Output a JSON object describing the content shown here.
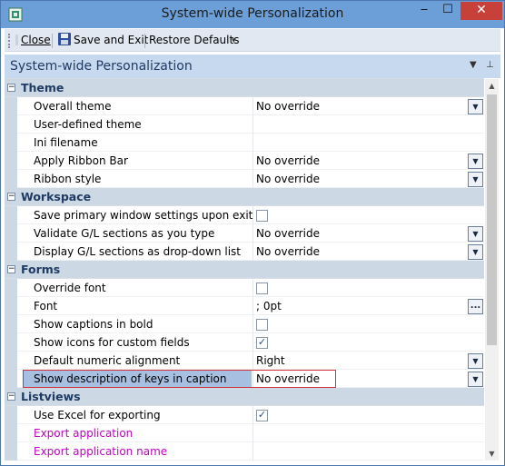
{
  "window": {
    "title": "System-wide Personalization",
    "minimize_glyph": "‒",
    "maximize_glyph": "☐",
    "close_glyph": "✕"
  },
  "toolbar": {
    "close_label": "Close",
    "save_label": "Save and Exit",
    "restore_label": "Restore Defaults"
  },
  "panel": {
    "title": "System-wide Personalization",
    "dropdown_glyph": "▼",
    "pin_glyph": "⊥"
  },
  "grid": {
    "categories": [
      {
        "label": "Theme",
        "toggle": "−",
        "rows": [
          {
            "label": "Overall theme",
            "type": "dropdown",
            "value": "No override"
          },
          {
            "label": "User-defined theme",
            "type": "text",
            "value": ""
          },
          {
            "label": "Ini filename",
            "type": "text",
            "value": ""
          },
          {
            "label": "Apply Ribbon Bar",
            "type": "dropdown",
            "value": "No override"
          },
          {
            "label": "Ribbon style",
            "type": "dropdown",
            "value": "No override"
          }
        ]
      },
      {
        "label": "Workspace",
        "toggle": "−",
        "rows": [
          {
            "label": "Save primary window settings upon exit",
            "type": "checkbox",
            "checked": false
          },
          {
            "label": "Validate G/L sections as you type",
            "type": "dropdown",
            "value": "No override"
          },
          {
            "label": "Display G/L sections as drop-down list",
            "type": "dropdown",
            "value": "No override"
          }
        ]
      },
      {
        "label": "Forms",
        "toggle": "−",
        "rows": [
          {
            "label": "Override font",
            "type": "checkbox",
            "checked": false
          },
          {
            "label": "Font",
            "type": "ellipsis",
            "value": "; 0pt"
          },
          {
            "label": "Show captions in bold",
            "type": "checkbox",
            "checked": false
          },
          {
            "label": "Show icons for custom fields",
            "type": "checkbox",
            "checked": true
          },
          {
            "label": "Default numeric alignment",
            "type": "dropdown",
            "value": "Right"
          },
          {
            "label": "Show description of keys in caption",
            "type": "dropdown",
            "value": "No override",
            "selected": true
          }
        ]
      },
      {
        "label": "Listviews",
        "toggle": "−",
        "rows": [
          {
            "label": "Use Excel for exporting",
            "type": "checkbox",
            "checked": true
          },
          {
            "label": "Export application",
            "type": "text",
            "value": "",
            "color": "pink"
          },
          {
            "label": "Export application name",
            "type": "text",
            "value": "",
            "color": "pink"
          }
        ]
      }
    ]
  },
  "icons": {
    "dropdown": "▼",
    "ellipsis": "...",
    "check": "✓",
    "scroll_up": "▲",
    "scroll_down": "▼"
  },
  "colors": {
    "titlebar": "#6c9fd8",
    "close_button": "#c7403a",
    "panel_header": "#c7d9ef",
    "category_bg": "#cdd8e5",
    "selected_row": "#a7bfe0",
    "highlight_border": "#d2313c",
    "pink_text": "#c000c0"
  }
}
